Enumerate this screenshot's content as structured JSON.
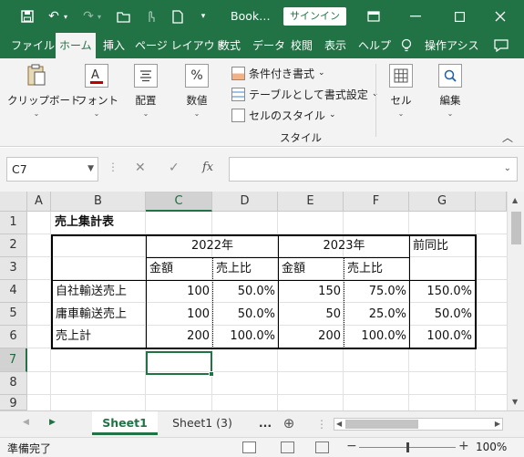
{
  "titlebar": {
    "title": "Book…",
    "signin": "サインイン"
  },
  "tabs": [
    "ファイル",
    "ホーム",
    "挿入",
    "ページ レイアウト",
    "数式",
    "データ",
    "校閲",
    "表示",
    "ヘルプ",
    "操作アシス"
  ],
  "ribbon": {
    "clipboard": "クリップボード",
    "font": "フォント",
    "alignment": "配置",
    "number": "数値",
    "conditional": "条件付き書式",
    "table_format": "テーブルとして書式設定",
    "cell_style": "セルのスタイル",
    "style_group": "スタイル",
    "cells": "セル",
    "editing": "編集"
  },
  "formula_bar": {
    "name_box": "C7",
    "fx": "fx",
    "value": ""
  },
  "grid": {
    "columns": [
      "A",
      "B",
      "C",
      "D",
      "E",
      "F",
      "G"
    ],
    "rows": [
      "1",
      "2",
      "3",
      "4",
      "5",
      "6",
      "7",
      "8",
      "9"
    ],
    "b1": "売上集計表",
    "c2": "2022年",
    "e2": "2023年",
    "g2": "前同比",
    "c3": "金額",
    "d3": "売上比",
    "e3": "金額",
    "f3": "売上比",
    "body": [
      {
        "label": "自社輸送売上",
        "c": "100",
        "d": "50.0%",
        "e": "150",
        "f": "75.0%",
        "g": "150.0%"
      },
      {
        "label": "庸車輸送売上",
        "c": "100",
        "d": "50.0%",
        "e": "50",
        "f": "25.0%",
        "g": "50.0%"
      },
      {
        "label": "売上計",
        "c": "200",
        "d": "100.0%",
        "e": "200",
        "f": "100.0%",
        "g": "100.0%"
      }
    ]
  },
  "sheets": {
    "tabs": [
      "Sheet1",
      "Sheet1 (3)"
    ],
    "more": "...",
    "add": "⊕"
  },
  "status": {
    "text": "準備完了",
    "zoom": "100%"
  }
}
